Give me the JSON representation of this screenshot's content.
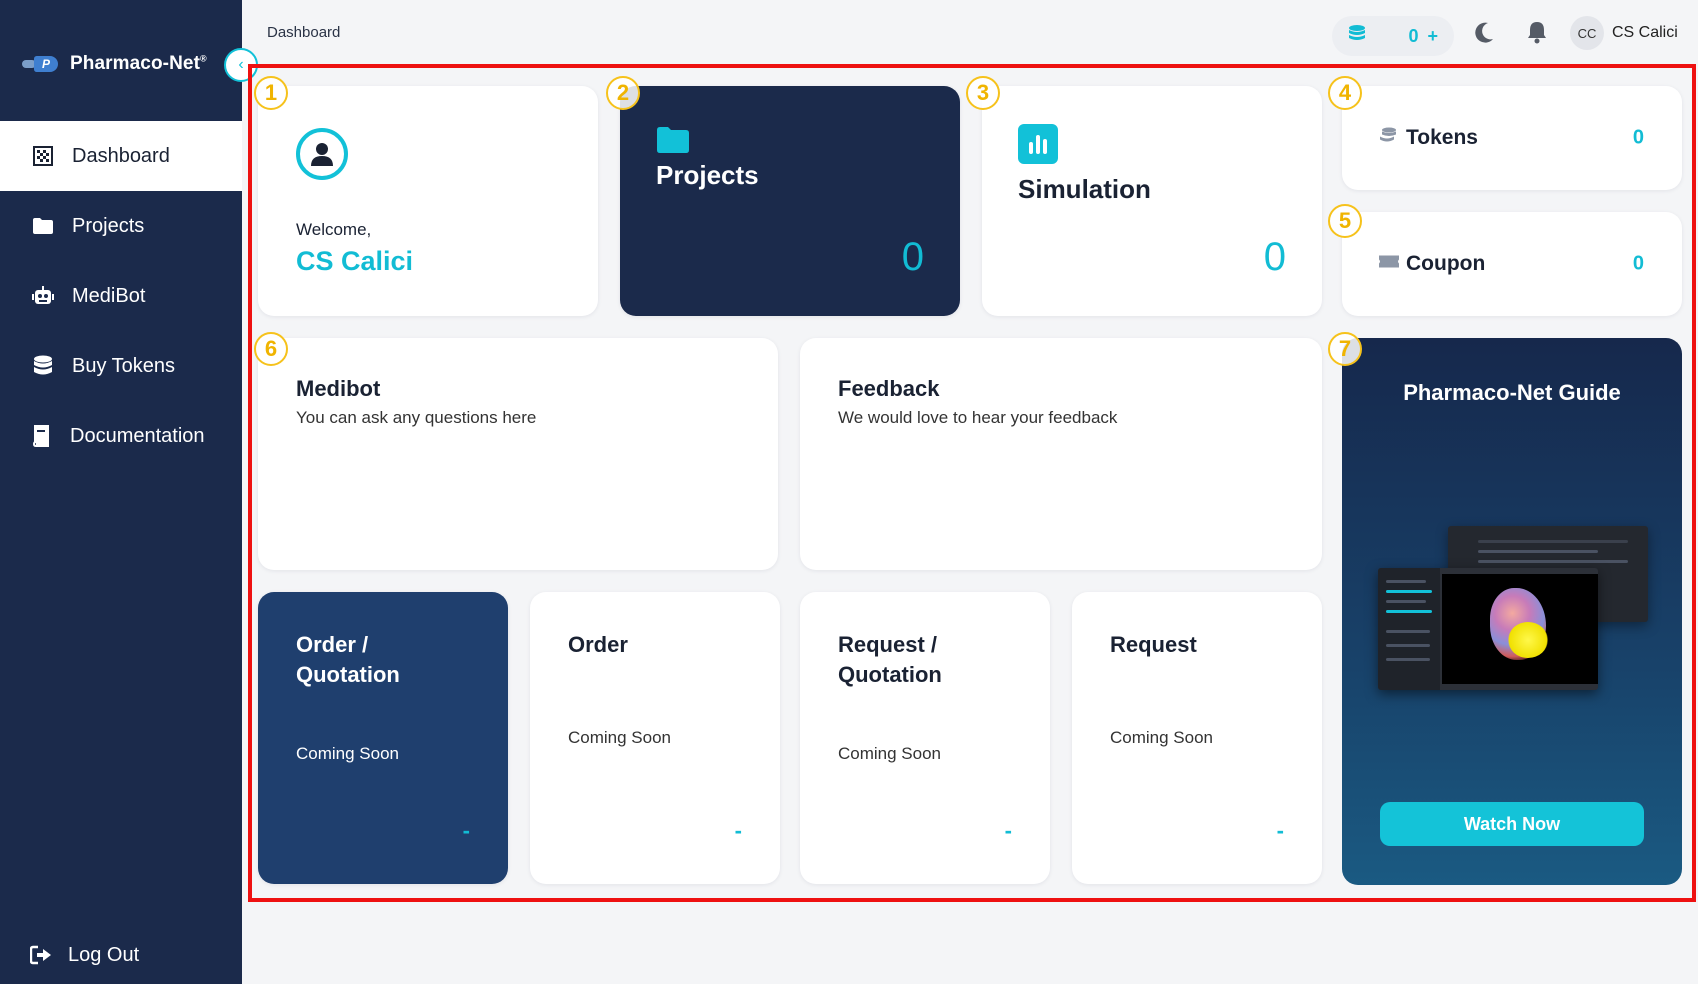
{
  "brand": {
    "name": "Pharmaco-Net",
    "mark": "®",
    "logo_letter": "P"
  },
  "header": {
    "breadcrumb": "Dashboard",
    "tokens_value": "0",
    "tokens_plus": "+",
    "user_initials": "CC",
    "user_name": "CS Calici"
  },
  "sidebar": {
    "items": [
      {
        "label": "Dashboard",
        "icon": "grid-icon",
        "active": true
      },
      {
        "label": "Projects",
        "icon": "folder-icon"
      },
      {
        "label": "MediBot",
        "icon": "robot-icon"
      },
      {
        "label": "Buy Tokens",
        "icon": "database-icon"
      },
      {
        "label": "Documentation",
        "icon": "book-icon"
      }
    ],
    "logout": "Log Out"
  },
  "badges": [
    "1",
    "2",
    "3",
    "4",
    "5",
    "6",
    "7"
  ],
  "welcome": {
    "label": "Welcome,",
    "name": "CS Calici"
  },
  "projects": {
    "title": "Projects",
    "count": "0"
  },
  "simulation": {
    "title": "Simulation",
    "count": "0"
  },
  "tokens": {
    "title": "Tokens",
    "value": "0"
  },
  "coupon": {
    "title": "Coupon",
    "value": "0"
  },
  "medibot": {
    "title": "Medibot",
    "subtitle": "You can ask any questions here"
  },
  "feedback": {
    "title": "Feedback",
    "subtitle": "We would love to hear your feedback"
  },
  "tiles": [
    {
      "title": "Order / Quotation",
      "status": "Coming Soon",
      "value": "-"
    },
    {
      "title": "Order",
      "status": "Coming Soon",
      "value": "-"
    },
    {
      "title": "Request / Quotation",
      "status": "Coming Soon",
      "value": "-"
    },
    {
      "title": "Request",
      "status": "Coming Soon",
      "value": "-"
    }
  ],
  "guide": {
    "title": "Pharmaco-Net Guide",
    "button": "Watch Now"
  },
  "colors": {
    "sidebar": "#1b2a4b",
    "accent": "#12bcd4",
    "frame": "#ee1111",
    "badge": "#f6c21b",
    "dark_card": "#1b2a4b",
    "tile_dark": "#1f3f6e"
  }
}
